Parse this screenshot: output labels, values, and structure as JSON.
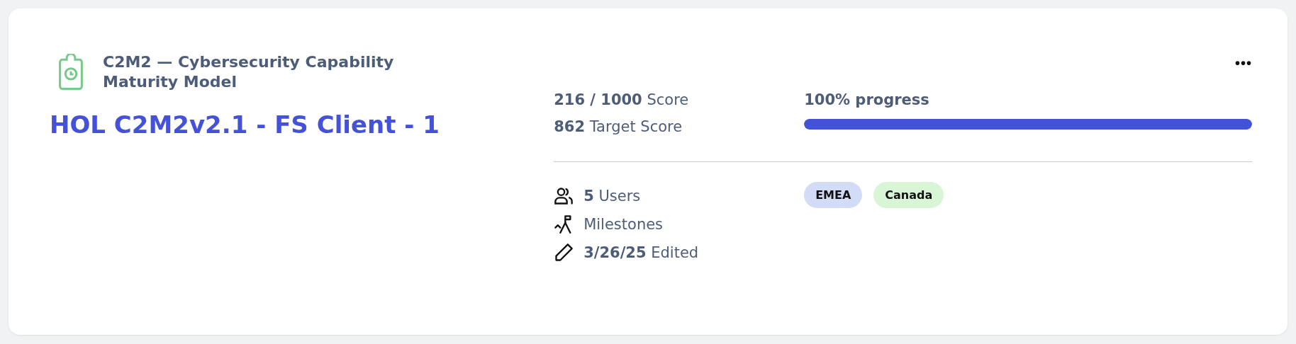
{
  "card": {
    "category": "C2M2 — Cybersecurity Capability Maturity Model",
    "title": "HOL C2M2v2.1 - FS Client - 1",
    "menu_icon": "•••",
    "scores": [
      "**216 / 1000** Score",
      "**862** Target Score"
    ],
    "progress": {
      "label": "100% progress",
      "level": 1
    },
    "meta": [
      {
        "kind": "users",
        "text": "**5** Users"
      },
      {
        "kind": "milestones",
        "text": "Milestones"
      },
      {
        "kind": "edited",
        "text": "**3/26/25** Edited"
      }
    ],
    "tags": [
      {
        "label": "EMEA",
        "color": "#d3dcf7"
      },
      {
        "label": "Canada",
        "color": "#d8f5d6"
      }
    ]
  }
}
